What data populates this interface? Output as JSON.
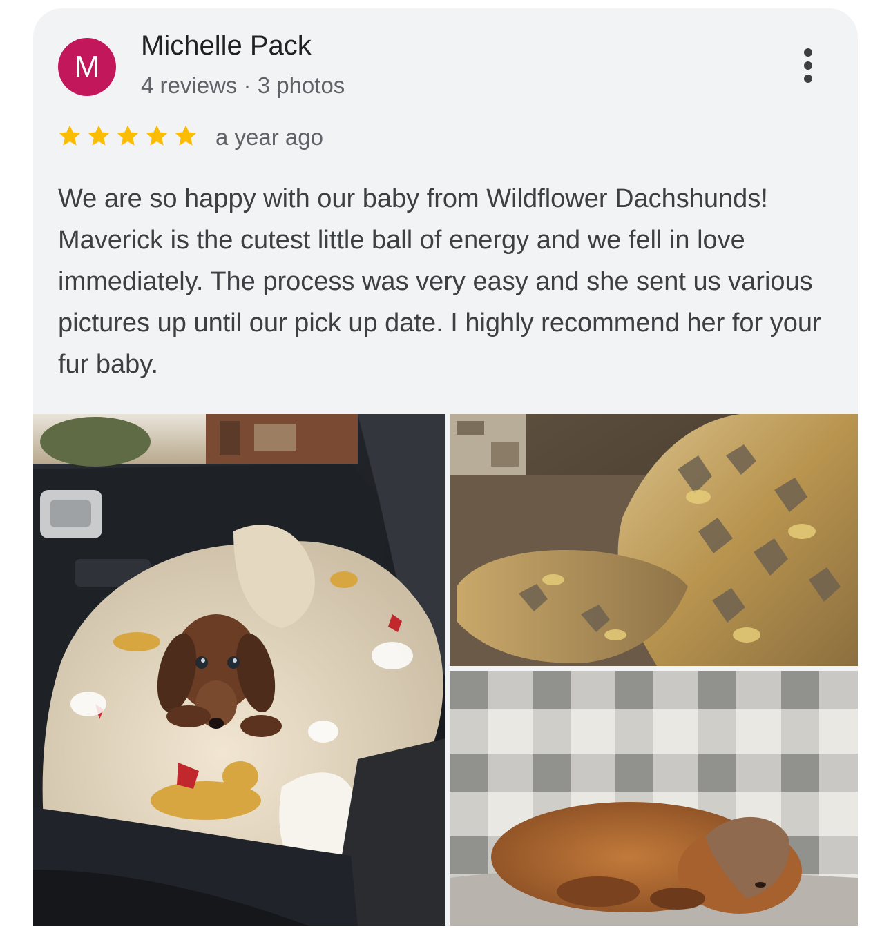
{
  "review": {
    "author": {
      "initial": "M",
      "name": "Michelle Pack",
      "meta": "4 reviews · 3 photos",
      "avatar_color": "#c2185b"
    },
    "rating": 5,
    "max_rating": 5,
    "star_color": "#fbbc04",
    "date": "a year ago",
    "text": "We are so happy with our baby from Wildflower Dachshunds! Maverick is the cutest little ball of energy and we fell in love immediately. The process was very easy and she sent us various pictures up until our pick up date. I highly recommend her for your fur baby.",
    "photos": [
      {
        "icon": "photo-dachshund-puppy-in-car-on-blanket"
      },
      {
        "icon": "photo-patterned-couch-pillows"
      },
      {
        "icon": "photo-puppy-sleeping-under-plaid-blanket"
      }
    ]
  }
}
